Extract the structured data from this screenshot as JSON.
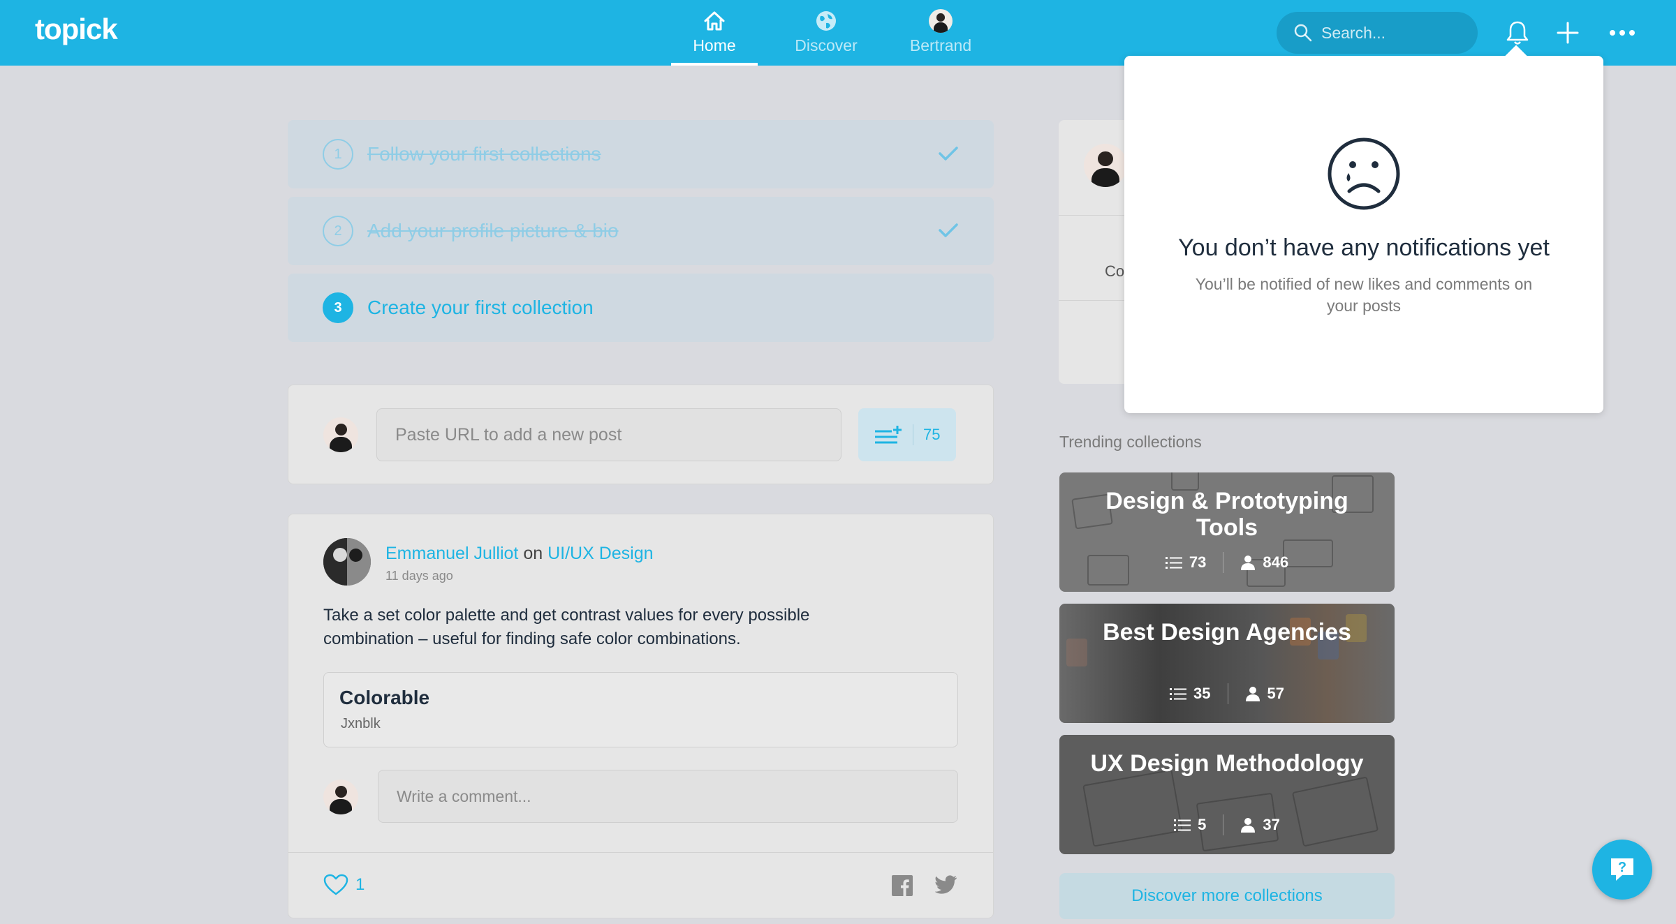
{
  "app": {
    "logo": "topick"
  },
  "nav": [
    {
      "label": "Home",
      "icon": "home-icon",
      "active": true
    },
    {
      "label": "Discover",
      "icon": "globe-icon",
      "active": false
    },
    {
      "label": "Bertrand",
      "icon": "avatar",
      "active": false
    }
  ],
  "search": {
    "placeholder": "Search..."
  },
  "onboarding": {
    "steps": [
      {
        "number": "1",
        "label": "Follow your first collections",
        "done": true
      },
      {
        "number": "2",
        "label": "Add your profile picture & bio",
        "done": true
      },
      {
        "number": "3",
        "label": "Create your first collection",
        "done": false
      }
    ]
  },
  "composer": {
    "placeholder": "Paste URL to add a new post",
    "count": "75"
  },
  "post": {
    "author": "Emmanuel Julliot",
    "connector": "on",
    "collection": "UI/UX Design",
    "time": "11 days ago",
    "text": "Take a set color palette and get contrast values for every possible combination – useful for finding safe color combinations.",
    "link_title": "Colorable",
    "link_source": "Jxnblk",
    "comment_placeholder": "Write a comment...",
    "likes": "1"
  },
  "profile_card": {
    "partial_label": "Co"
  },
  "trending": {
    "title": "Trending collections",
    "collections": [
      {
        "title": "Design & Prototyping Tools",
        "posts": "73",
        "followers": "846"
      },
      {
        "title": "Best Design Agencies",
        "posts": "35",
        "followers": "57"
      },
      {
        "title": "UX Design Methodology",
        "posts": "5",
        "followers": "37"
      }
    ],
    "more_label": "Discover more collections"
  },
  "notifications": {
    "title": "You don’t have any notifications yet",
    "subtitle": "You’ll be notified of new likes and comments on your posts"
  },
  "colors": {
    "accent": "#1eb4e3",
    "background": "#d9dadf",
    "card": "#e6e6e6"
  }
}
